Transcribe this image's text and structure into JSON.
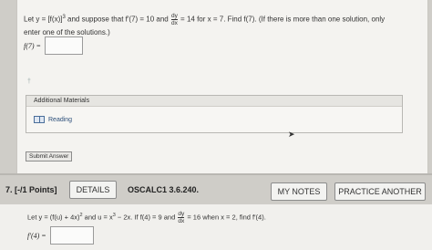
{
  "q6": {
    "text_1": "Let y = [f(x)]",
    "exp_1": "3",
    "text_2": " and suppose that f′(7) = 10 and ",
    "frac_num": "dy",
    "frac_den": "dx",
    "text_3": " = 14 for x = 7. Find f(7). (If there is more than one solution, only",
    "text_4": "enter one of the solutions.)",
    "answer_label": "f(7) =",
    "answer_value": "",
    "ghost_mark": "†"
  },
  "additional_materials": {
    "title": "Additional Materials",
    "link_label": "Reading",
    "icon": "book-icon"
  },
  "submit_label": "Submit Answer",
  "q7": {
    "points": "7.  [-/1 Points]",
    "details_label": "DETAILS",
    "code": "OSCALC1 3.6.240.",
    "my_notes_label": "MY NOTES",
    "practice_label": "PRACTICE ANOTHER",
    "text_1": "Let y = (f(u) + 4x)",
    "exp_1": "2",
    "text_2": " and u = x",
    "exp_2": "3",
    "text_3": " − 2x. If f(4) = 9 and ",
    "frac_num": "dy",
    "frac_den": "dx",
    "text_4": " = 16 when x = 2, find f′(4).",
    "answer_label": "f′(4) =",
    "answer_value": ""
  },
  "colors": {
    "background": "#cfcdc8",
    "panel": "#f4f3f0",
    "link": "#2c4f7a"
  }
}
